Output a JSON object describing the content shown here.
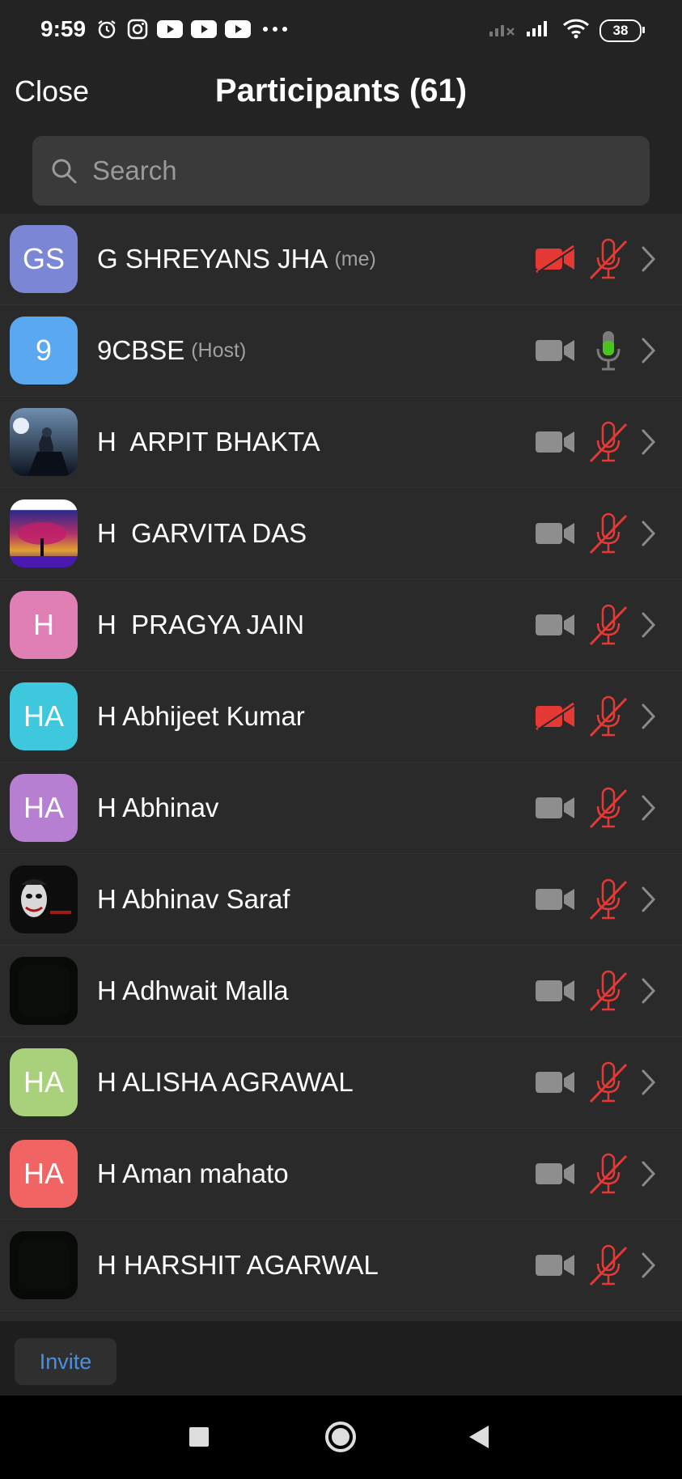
{
  "status": {
    "time": "9:59",
    "battery": "38"
  },
  "header": {
    "close": "Close",
    "title": "Participants (61)"
  },
  "search": {
    "placeholder": "Search"
  },
  "participants": [
    {
      "initials": "GS",
      "name": "G SHREYANS JHA",
      "tag": "(me)",
      "avatar_color": "#7b86d4",
      "video": "off",
      "audio": "muted"
    },
    {
      "initials": "9",
      "name": "9CBSE",
      "tag": "(Host)",
      "avatar_color": "#5aa9f0",
      "video": "on",
      "audio": "live"
    },
    {
      "initials": "",
      "name": "H  ARPIT BHAKTA",
      "tag": "",
      "avatar_color": "#1e2a3a",
      "video": "on",
      "audio": "muted",
      "photo": "warrior"
    },
    {
      "initials": "",
      "name": "H  GARVITA DAS",
      "tag": "",
      "avatar_color": "#3a1a5a",
      "video": "on",
      "audio": "muted",
      "photo": "tree"
    },
    {
      "initials": "H",
      "name": "H  PRAGYA JAIN",
      "tag": "",
      "avatar_color": "#e07fb4",
      "video": "on",
      "audio": "muted"
    },
    {
      "initials": "HA",
      "name": "H Abhijeet Kumar",
      "tag": "",
      "avatar_color": "#3ec8de",
      "video": "off",
      "audio": "muted"
    },
    {
      "initials": "HA",
      "name": "H Abhinav",
      "tag": "",
      "avatar_color": "#b77fd1",
      "video": "on",
      "audio": "muted"
    },
    {
      "initials": "",
      "name": "H Abhinav Saraf",
      "tag": "",
      "avatar_color": "#111111",
      "video": "on",
      "audio": "muted",
      "photo": "joker"
    },
    {
      "initials": "",
      "name": "H Adhwait Malla",
      "tag": "",
      "avatar_color": "#050b05",
      "video": "on",
      "audio": "muted",
      "photo": "dark"
    },
    {
      "initials": "HA",
      "name": "H ALISHA AGRAWAL",
      "tag": "",
      "avatar_color": "#a9d07a",
      "video": "on",
      "audio": "muted"
    },
    {
      "initials": "HA",
      "name": "H Aman mahato",
      "tag": "",
      "avatar_color": "#f06464",
      "video": "on",
      "audio": "muted"
    },
    {
      "initials": "",
      "name": "H HARSHIT AGARWAL",
      "tag": "",
      "avatar_color": "#080808",
      "video": "on",
      "audio": "muted",
      "photo": "dark"
    }
  ],
  "footer": {
    "invite": "Invite"
  },
  "colors": {
    "muted_red": "#e53935",
    "live_green": "#4cc41f",
    "camera_gray": "#8e8e8e"
  }
}
